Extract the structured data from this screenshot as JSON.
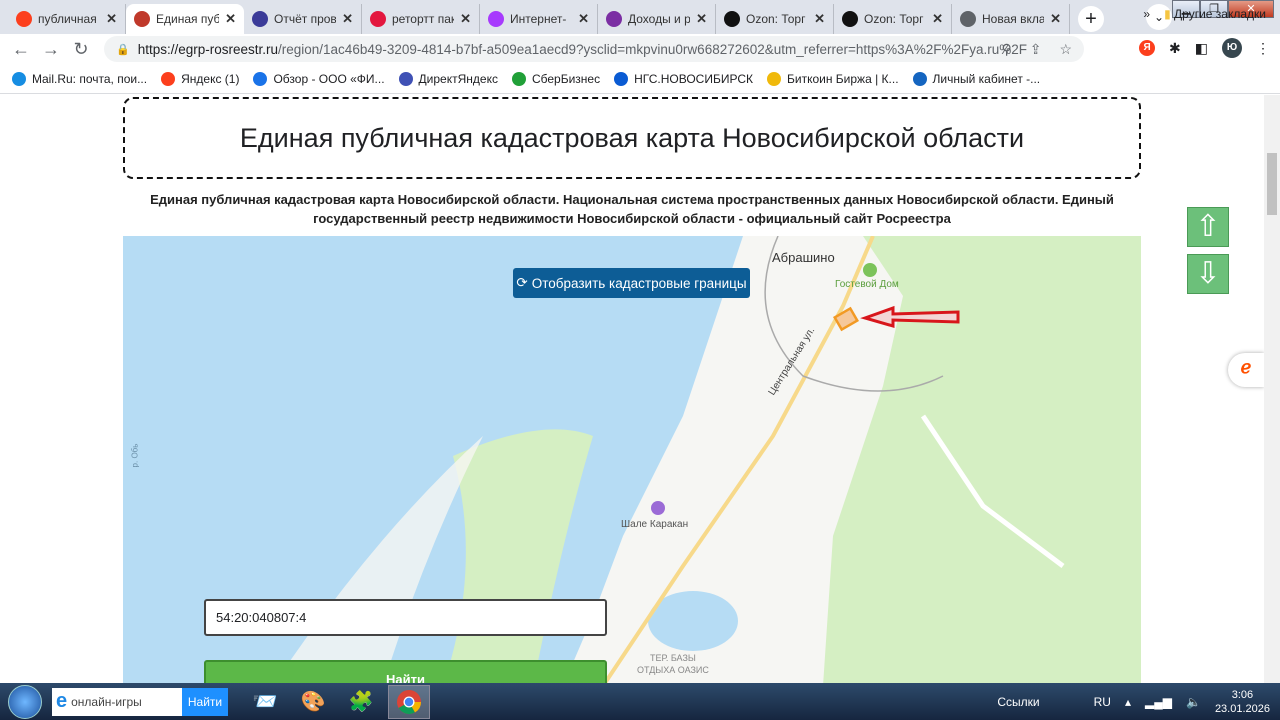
{
  "browser": {
    "tabs": [
      {
        "title": "публичная",
        "icon": "yandex-icon",
        "color": "#fc3f1d",
        "active": false
      },
      {
        "title": "Единая пуб",
        "icon": "rosreestr-emblem-icon",
        "color": "#c0392b",
        "active": true
      },
      {
        "title": "Отчёт пров",
        "icon": "report-icon",
        "color": "#3b3b98",
        "active": false
      },
      {
        "title": "ретортт пак",
        "icon": "ozon-red-icon",
        "color": "#e3173e",
        "active": false
      },
      {
        "title": "Интернет-",
        "icon": "wildberries-icon",
        "color": "#a73afd",
        "active": false
      },
      {
        "title": "Доходы и р",
        "icon": "w-icon",
        "color": "#7b2ea3",
        "active": false
      },
      {
        "title": "Ozon: Торг",
        "icon": "ozon-icon",
        "color": "#111111",
        "active": false
      },
      {
        "title": "Ozon: Торг",
        "icon": "ozon-icon",
        "color": "#111111",
        "active": false
      },
      {
        "title": "Новая вкла",
        "icon": "chrome-icon",
        "color": "#5f6368",
        "active": false
      }
    ],
    "url_host": "https://egrp-rosreestr.ru",
    "url_rest": "/region/1ac46b49-3209-4814-b7bf-a509ea1aecd9?ysclid=mkpvinu0rw668272602&utm_referrer=https%3A%2F%2Fya.ru%2F",
    "profile_initial": "Ю",
    "bookmarks": [
      {
        "label": "Mail.Ru: почта, пои...",
        "color": "#168de2"
      },
      {
        "label": "Яндекс (1)",
        "color": "#fc3f1d"
      },
      {
        "label": "Обзор - ООО «ФИ...",
        "color": "#1a73e8"
      },
      {
        "label": "ДиректЯндекс",
        "color": "#3f51b5"
      },
      {
        "label": "СберБизнес",
        "color": "#21a038"
      },
      {
        "label": "НГС.НОВОСИБИРСК",
        "color": "#0a5bd3"
      },
      {
        "label": "Биткоин Биржа | К...",
        "color": "#f0b90b"
      },
      {
        "label": "Личный кабинет -...",
        "color": "#1565c0"
      }
    ],
    "more_bookmarks": "»",
    "other_bookmarks": "Другие закладки"
  },
  "page": {
    "title": "Единая публичная кадастровая карта Новосибирской области",
    "description": "Единая публичная кадастровая карта Новосибирской области. Национальная система пространственных данных Новосибирской области. Единый государственный реестр недвижимости Новосибирской области - официальный сайт Росреестра",
    "show_borders_button": "Отобразить кадастровые границы",
    "map_labels": {
      "village": "Абрашино",
      "guest_house": "Гостевой Дом",
      "street": "Центральная ул.",
      "chalet": "Шале Каракан",
      "base1": "ТЕР. БАЗЫ",
      "base2": "ОТДЫХА ОАЗИС",
      "river": "р. Обь"
    },
    "search_value": "54:20:040807:4",
    "find_button": "Найти"
  },
  "taskbar": {
    "search_placeholder": "онлайн-игры",
    "search_button": "Найти",
    "links": "Ссылки",
    "lang": "RU",
    "time": "3:06",
    "date": "23.01.2026"
  }
}
